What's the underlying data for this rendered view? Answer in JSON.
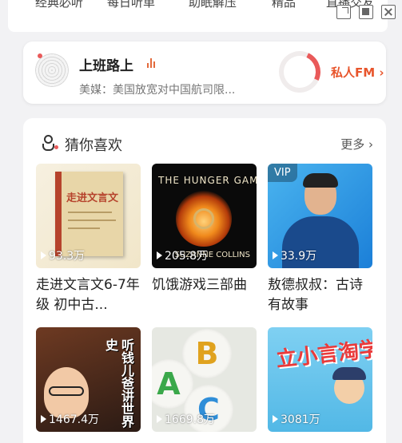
{
  "categories": [
    "经典必听",
    "每日听单",
    "助眠解压",
    "精品",
    "直播交友"
  ],
  "window_controls": [
    "float-window-icon",
    "minimize-icon",
    "close-icon"
  ],
  "fm_card": {
    "title": "上班路上",
    "subtitle": "美媒：美国放宽对中国航司限...",
    "link_label": "私人FM",
    "link_arrow": "›",
    "accent": "#e8552c"
  },
  "recommend": {
    "title": "猜你喜欢",
    "more_label": "更多",
    "more_arrow": "›",
    "items": [
      {
        "title": "走进文言文6-7年级 初中古...",
        "plays": "93.3万",
        "cover_text": "走进文言文",
        "vip": ""
      },
      {
        "title": "饥饿游戏三部曲",
        "plays": "205.8万",
        "cover_text": "THE HUNGER GAMES",
        "cover_author": "SUZANNE COLLINS",
        "vip": ""
      },
      {
        "title": "敖德叔叔：古诗有故事",
        "plays": "33.9万",
        "vip": "VIP"
      },
      {
        "title": "",
        "plays": "1467.4万",
        "cover_text": "听钱儿爸讲世界史",
        "vip": ""
      },
      {
        "title": "",
        "plays": "1669.8万",
        "cover_letters": [
          "B",
          "A",
          "C"
        ],
        "vip": ""
      },
      {
        "title": "",
        "plays": "3081万",
        "cover_text": "立小言淘学记",
        "vip": ""
      }
    ]
  }
}
